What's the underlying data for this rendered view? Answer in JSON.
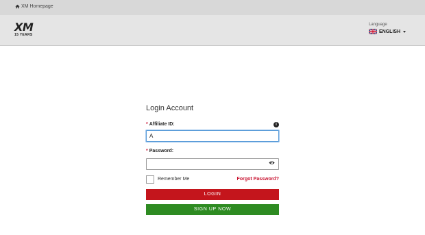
{
  "topbar": {
    "home_label": "XM Homepage",
    "home_icon": "home-icon"
  },
  "header": {
    "logo_mark": "XM",
    "logo_sub": "15 YEARS",
    "language_label": "Language",
    "language_value": "ENGLISH",
    "flag_icon": "uk-flag-icon"
  },
  "form": {
    "title": "Login Account",
    "affiliate_label": "Affiliate ID:",
    "affiliate_value": "A",
    "password_label": "Password:",
    "password_value": "",
    "remember_label": "Remember Me",
    "forgot_label": "Forgot Password?",
    "login_label": "LOGIN",
    "signup_label": "SIGN UP NOW",
    "required_mark": "*",
    "info_glyph": "i"
  },
  "colors": {
    "accent_red": "#c4151c",
    "accent_green": "#2e8b22"
  }
}
